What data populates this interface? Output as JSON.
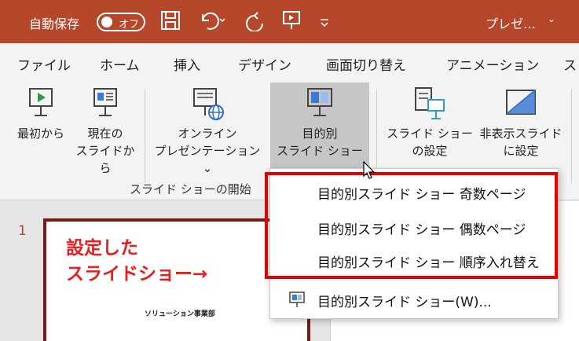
{
  "titlebar": {
    "autosave_label": "自動保存",
    "autosave_toggle": "オフ",
    "doc_title": "プレゼ…",
    "doc_caret": "⌄"
  },
  "tabs": [
    "ファイル",
    "ホーム",
    "挿入",
    "デザイン",
    "画面切り替え",
    "アニメーション",
    "ス"
  ],
  "ribbon": {
    "from_beginning": [
      "最初から"
    ],
    "from_current": [
      "現在の",
      "スライドから"
    ],
    "online": [
      "オンライン",
      "プレゼンテーション ⌄"
    ],
    "custom": [
      "目的別",
      "スライド ショー ⌄"
    ],
    "setup": [
      "スライド ショー",
      "の設定"
    ],
    "hide": [
      "非表示スライド",
      "に設定"
    ],
    "group_label": "スライド ショーの開始"
  },
  "slide": {
    "number": "1",
    "thumb_title": "ソリューション事業部",
    "annotation_line1": "設定した",
    "annotation_line2": "スライドショー→"
  },
  "menu": {
    "item1": "目的別スライド ショー 奇数ページ",
    "item2": "目的別スライド ショー 偶数ページ",
    "item3": "目的別スライド ショー 順序入れ替え",
    "item4": "目的別スライド ショー(W)..."
  },
  "colors": {
    "accent": "#b7472a",
    "highlight_box": "#e60000",
    "annotation": "#e81e1e"
  }
}
